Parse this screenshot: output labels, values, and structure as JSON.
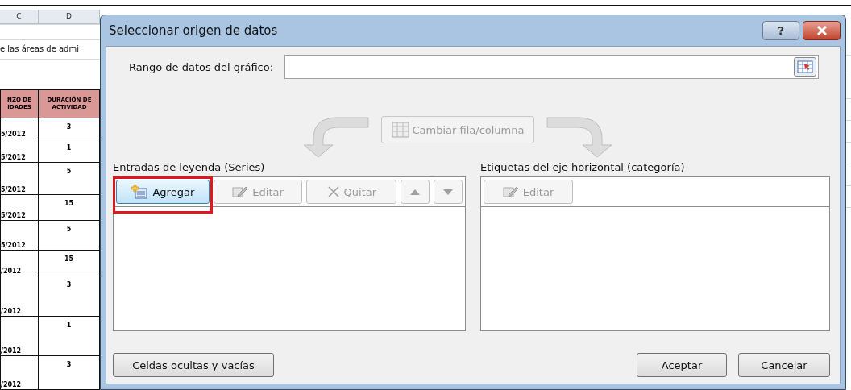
{
  "sheet": {
    "columns": [
      "C",
      "D"
    ],
    "title_fragment": "e las áreas de admi",
    "header": [
      "NZO DE IDADES",
      "DURACIÓN DE ACTIVIDAD"
    ],
    "rows": [
      {
        "date": "5/2012",
        "duration": "3"
      },
      {
        "date": "5/2012",
        "duration": "1"
      },
      {
        "date": "5/2012",
        "duration": "5"
      },
      {
        "date": "5/2012",
        "duration": "15"
      },
      {
        "date": "5/2012",
        "duration": "5"
      },
      {
        "date": "/2012",
        "duration": "15"
      },
      {
        "date": "/2012",
        "duration": "3"
      },
      {
        "date": "/2012",
        "duration": "1"
      },
      {
        "date": "/2012",
        "duration": "3"
      }
    ]
  },
  "dialog": {
    "title": "Seleccionar origen de datos",
    "help": "?",
    "range": {
      "label": "Rango de datos del gráfico:"
    },
    "switch_button": {
      "label": "Cambiar fila/columna",
      "disabled": true
    },
    "series_panel": {
      "label": "Entradas de leyenda (Series)",
      "buttons": [
        {
          "kind": "add",
          "label": "Agregar",
          "disabled": false,
          "highlighted": true
        },
        {
          "kind": "edit",
          "label": "Editar",
          "disabled": true,
          "highlighted": false
        },
        {
          "kind": "remove",
          "label": "Quitar",
          "disabled": true,
          "highlighted": false
        },
        {
          "kind": "up",
          "disabled": true,
          "highlighted": false
        },
        {
          "kind": "down",
          "disabled": true,
          "highlighted": false
        }
      ]
    },
    "category_panel": {
      "label": "Etiquetas del eje horizontal (categoría)",
      "buttons": [
        {
          "kind": "edit",
          "label": "Editar",
          "disabled": true,
          "highlighted": false
        }
      ]
    },
    "hidden_cells_button": "Celdas ocultas y vacías",
    "ok_button": "Aceptar",
    "cancel_button": "Cancelar"
  }
}
